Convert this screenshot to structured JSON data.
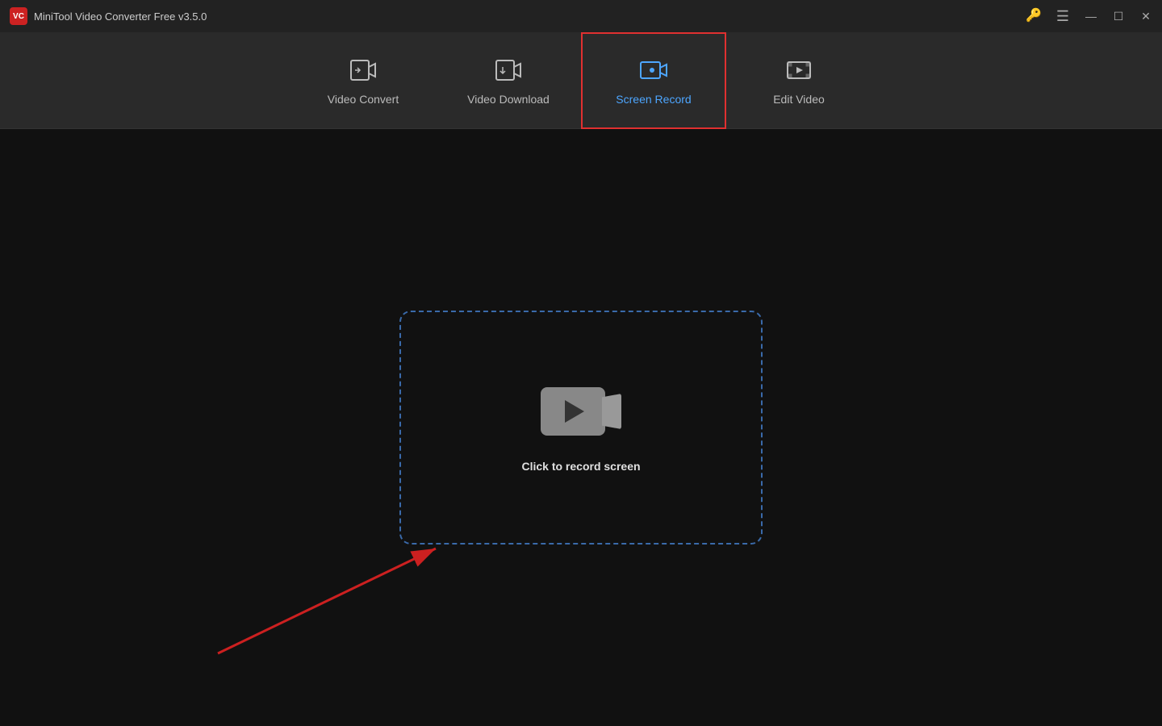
{
  "titlebar": {
    "logo": "VC",
    "title": "MiniTool Video Converter Free v3.5.0"
  },
  "nav": {
    "items": [
      {
        "id": "video-convert",
        "label": "Video Convert",
        "active": false
      },
      {
        "id": "video-download",
        "label": "Video Download",
        "active": false
      },
      {
        "id": "screen-record",
        "label": "Screen Record",
        "active": true
      },
      {
        "id": "edit-video",
        "label": "Edit Video",
        "active": false
      }
    ]
  },
  "main": {
    "record_prompt": "Click to record screen"
  },
  "titlebar_controls": {
    "minimize": "—",
    "maximize": "☐",
    "close": "✕"
  }
}
